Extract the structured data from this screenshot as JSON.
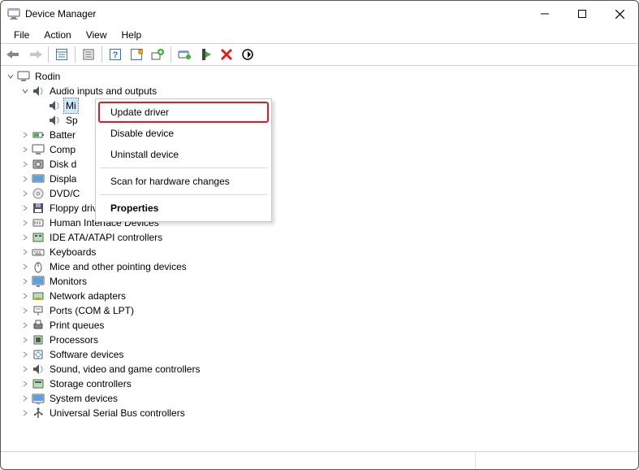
{
  "window": {
    "title": "Device Manager"
  },
  "menubar": {
    "items": [
      "File",
      "Action",
      "View",
      "Help"
    ]
  },
  "tree": {
    "root": "Rodin",
    "audio": {
      "label": "Audio inputs and outputs",
      "child0": "Mi",
      "child1": "Sp"
    },
    "cats": [
      "Batter",
      "Comp",
      "Disk d",
      "Displa",
      "DVD/C",
      "Floppy drive controllers",
      "Human Interface Devices",
      "IDE ATA/ATAPI controllers",
      "Keyboards",
      "Mice and other pointing devices",
      "Monitors",
      "Network adapters",
      "Ports (COM & LPT)",
      "Print queues",
      "Processors",
      "Software devices",
      "Sound, video and game controllers",
      "Storage controllers",
      "System devices",
      "Universal Serial Bus controllers"
    ]
  },
  "context_menu": {
    "items": [
      {
        "label": "Update driver",
        "highlighted": true
      },
      {
        "label": "Disable device"
      },
      {
        "label": "Uninstall device"
      },
      {
        "sep": true
      },
      {
        "label": "Scan for hardware changes"
      },
      {
        "sep": true
      },
      {
        "label": "Properties",
        "bold": true
      }
    ]
  }
}
